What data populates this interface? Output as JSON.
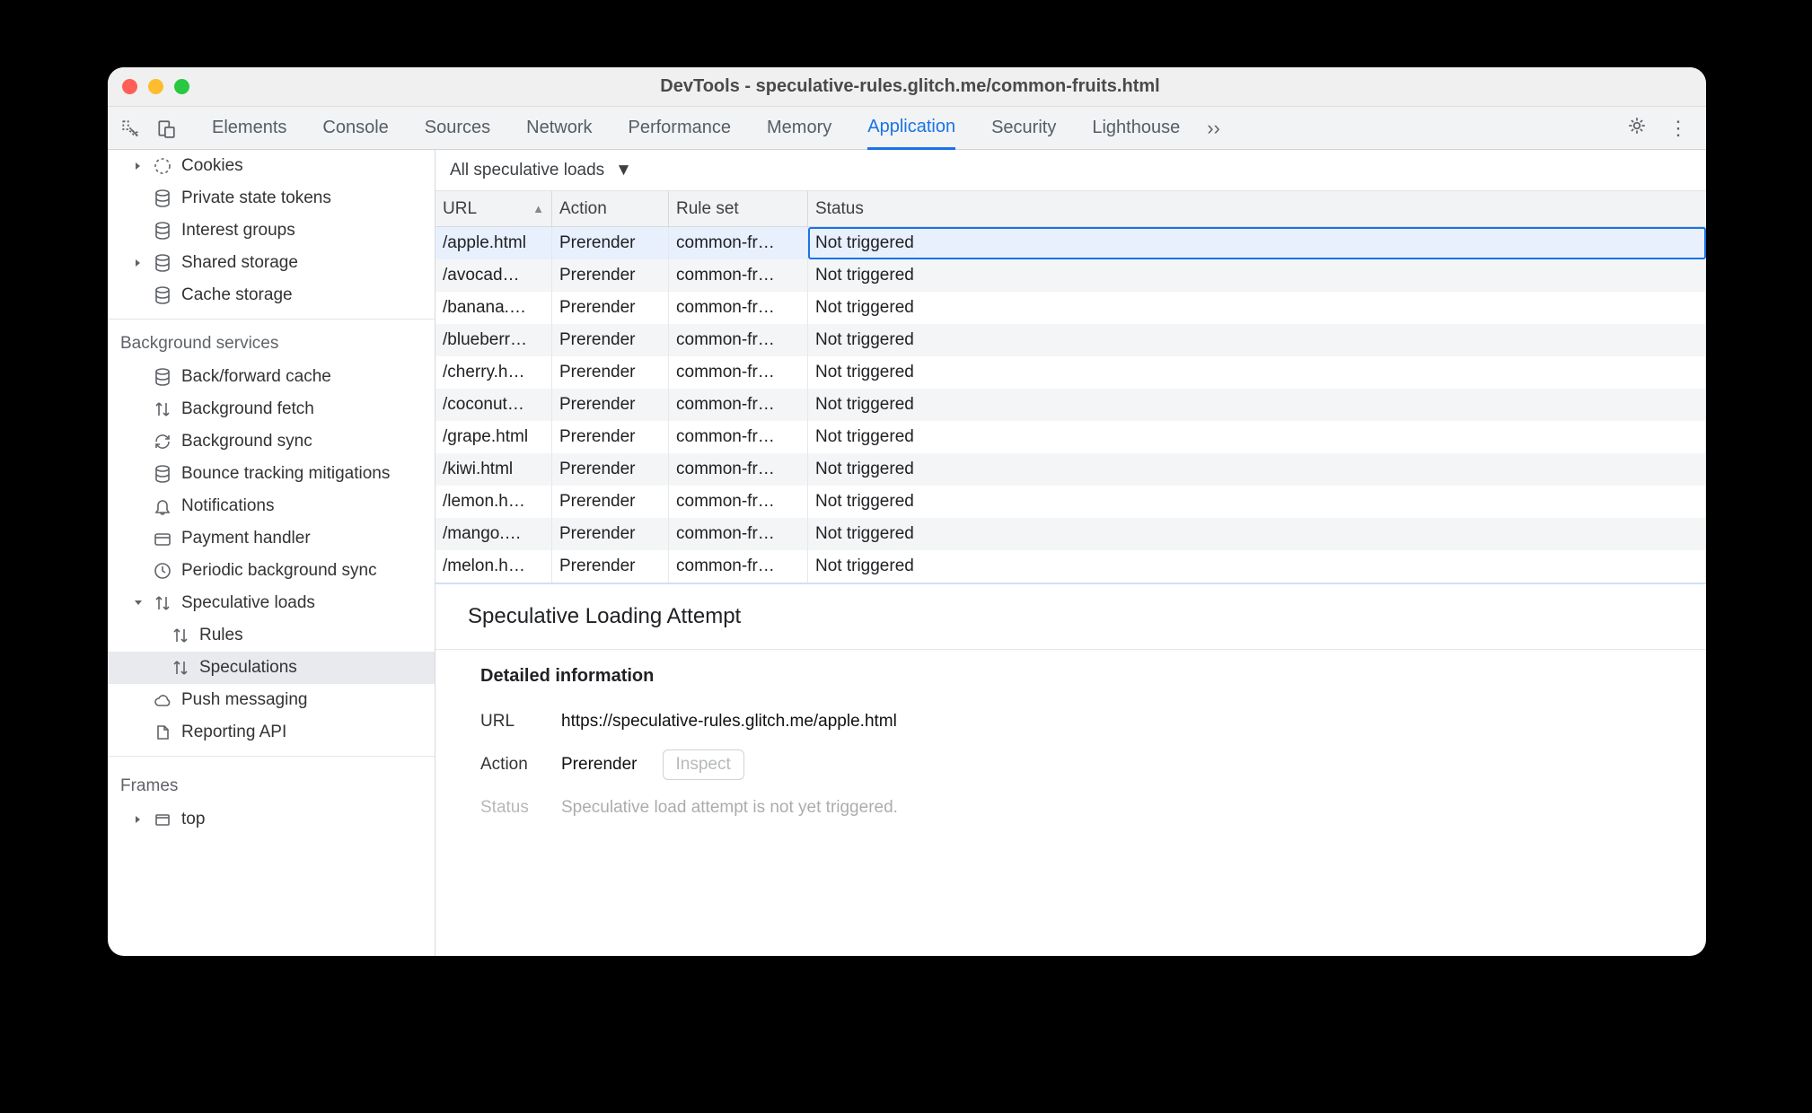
{
  "window": {
    "title": "DevTools - speculative-rules.glitch.me/common-fruits.html"
  },
  "tabs": [
    {
      "label": "Elements",
      "active": false
    },
    {
      "label": "Console",
      "active": false
    },
    {
      "label": "Sources",
      "active": false
    },
    {
      "label": "Network",
      "active": false
    },
    {
      "label": "Performance",
      "active": false
    },
    {
      "label": "Memory",
      "active": false
    },
    {
      "label": "Application",
      "active": true
    },
    {
      "label": "Security",
      "active": false
    },
    {
      "label": "Lighthouse",
      "active": false
    }
  ],
  "sidebar": {
    "storage": [
      {
        "label": "Cookies",
        "icon": "cookie",
        "caret": "right",
        "indent": 1
      },
      {
        "label": "Private state tokens",
        "icon": "database",
        "caret": "none",
        "indent": 1
      },
      {
        "label": "Interest groups",
        "icon": "database",
        "caret": "none",
        "indent": 1
      },
      {
        "label": "Shared storage",
        "icon": "database",
        "caret": "right",
        "indent": 1
      },
      {
        "label": "Cache storage",
        "icon": "database",
        "caret": "none",
        "indent": 1
      }
    ],
    "bg_title": "Background services",
    "bg": [
      {
        "label": "Back/forward cache",
        "icon": "database",
        "caret": "none",
        "indent": 1
      },
      {
        "label": "Background fetch",
        "icon": "updown",
        "caret": "none",
        "indent": 1
      },
      {
        "label": "Background sync",
        "icon": "sync",
        "caret": "none",
        "indent": 1
      },
      {
        "label": "Bounce tracking mitigations",
        "icon": "database",
        "caret": "none",
        "indent": 1
      },
      {
        "label": "Notifications",
        "icon": "bell",
        "caret": "none",
        "indent": 1
      },
      {
        "label": "Payment handler",
        "icon": "card",
        "caret": "none",
        "indent": 1
      },
      {
        "label": "Periodic background sync",
        "icon": "clock",
        "caret": "none",
        "indent": 1
      },
      {
        "label": "Speculative loads",
        "icon": "updown",
        "caret": "down",
        "indent": 1
      },
      {
        "label": "Rules",
        "icon": "updown",
        "caret": "none",
        "indent": 2
      },
      {
        "label": "Speculations",
        "icon": "updown",
        "caret": "none",
        "indent": 2,
        "selected": true
      },
      {
        "label": "Push messaging",
        "icon": "cloud",
        "caret": "none",
        "indent": 1
      },
      {
        "label": "Reporting API",
        "icon": "doc",
        "caret": "none",
        "indent": 1
      }
    ],
    "frames_title": "Frames",
    "frames": [
      {
        "label": "top",
        "icon": "frame",
        "caret": "right",
        "indent": 1
      }
    ]
  },
  "filter": {
    "label": "All speculative loads"
  },
  "table": {
    "headers": {
      "url": "URL",
      "action": "Action",
      "rule": "Rule set",
      "status": "Status"
    },
    "rows": [
      {
        "url": "/apple.html",
        "action": "Prerender",
        "rule": "common-fr…",
        "status": "Not triggered",
        "selected": true
      },
      {
        "url": "/avocad…",
        "action": "Prerender",
        "rule": "common-fr…",
        "status": "Not triggered"
      },
      {
        "url": "/banana.…",
        "action": "Prerender",
        "rule": "common-fr…",
        "status": "Not triggered"
      },
      {
        "url": "/blueberr…",
        "action": "Prerender",
        "rule": "common-fr…",
        "status": "Not triggered"
      },
      {
        "url": "/cherry.h…",
        "action": "Prerender",
        "rule": "common-fr…",
        "status": "Not triggered"
      },
      {
        "url": "/coconut…",
        "action": "Prerender",
        "rule": "common-fr…",
        "status": "Not triggered"
      },
      {
        "url": "/grape.html",
        "action": "Prerender",
        "rule": "common-fr…",
        "status": "Not triggered"
      },
      {
        "url": "/kiwi.html",
        "action": "Prerender",
        "rule": "common-fr…",
        "status": "Not triggered"
      },
      {
        "url": "/lemon.h…",
        "action": "Prerender",
        "rule": "common-fr…",
        "status": "Not triggered"
      },
      {
        "url": "/mango.…",
        "action": "Prerender",
        "rule": "common-fr…",
        "status": "Not triggered"
      },
      {
        "url": "/melon.h…",
        "action": "Prerender",
        "rule": "common-fr…",
        "status": "Not triggered"
      }
    ]
  },
  "details": {
    "heading": "Speculative Loading Attempt",
    "section": "Detailed information",
    "url_k": "URL",
    "url_v": "https://speculative-rules.glitch.me/apple.html",
    "action_k": "Action",
    "action_v": "Prerender",
    "inspect": "Inspect",
    "status_k": "Status",
    "status_v": "Speculative load attempt is not yet triggered."
  }
}
